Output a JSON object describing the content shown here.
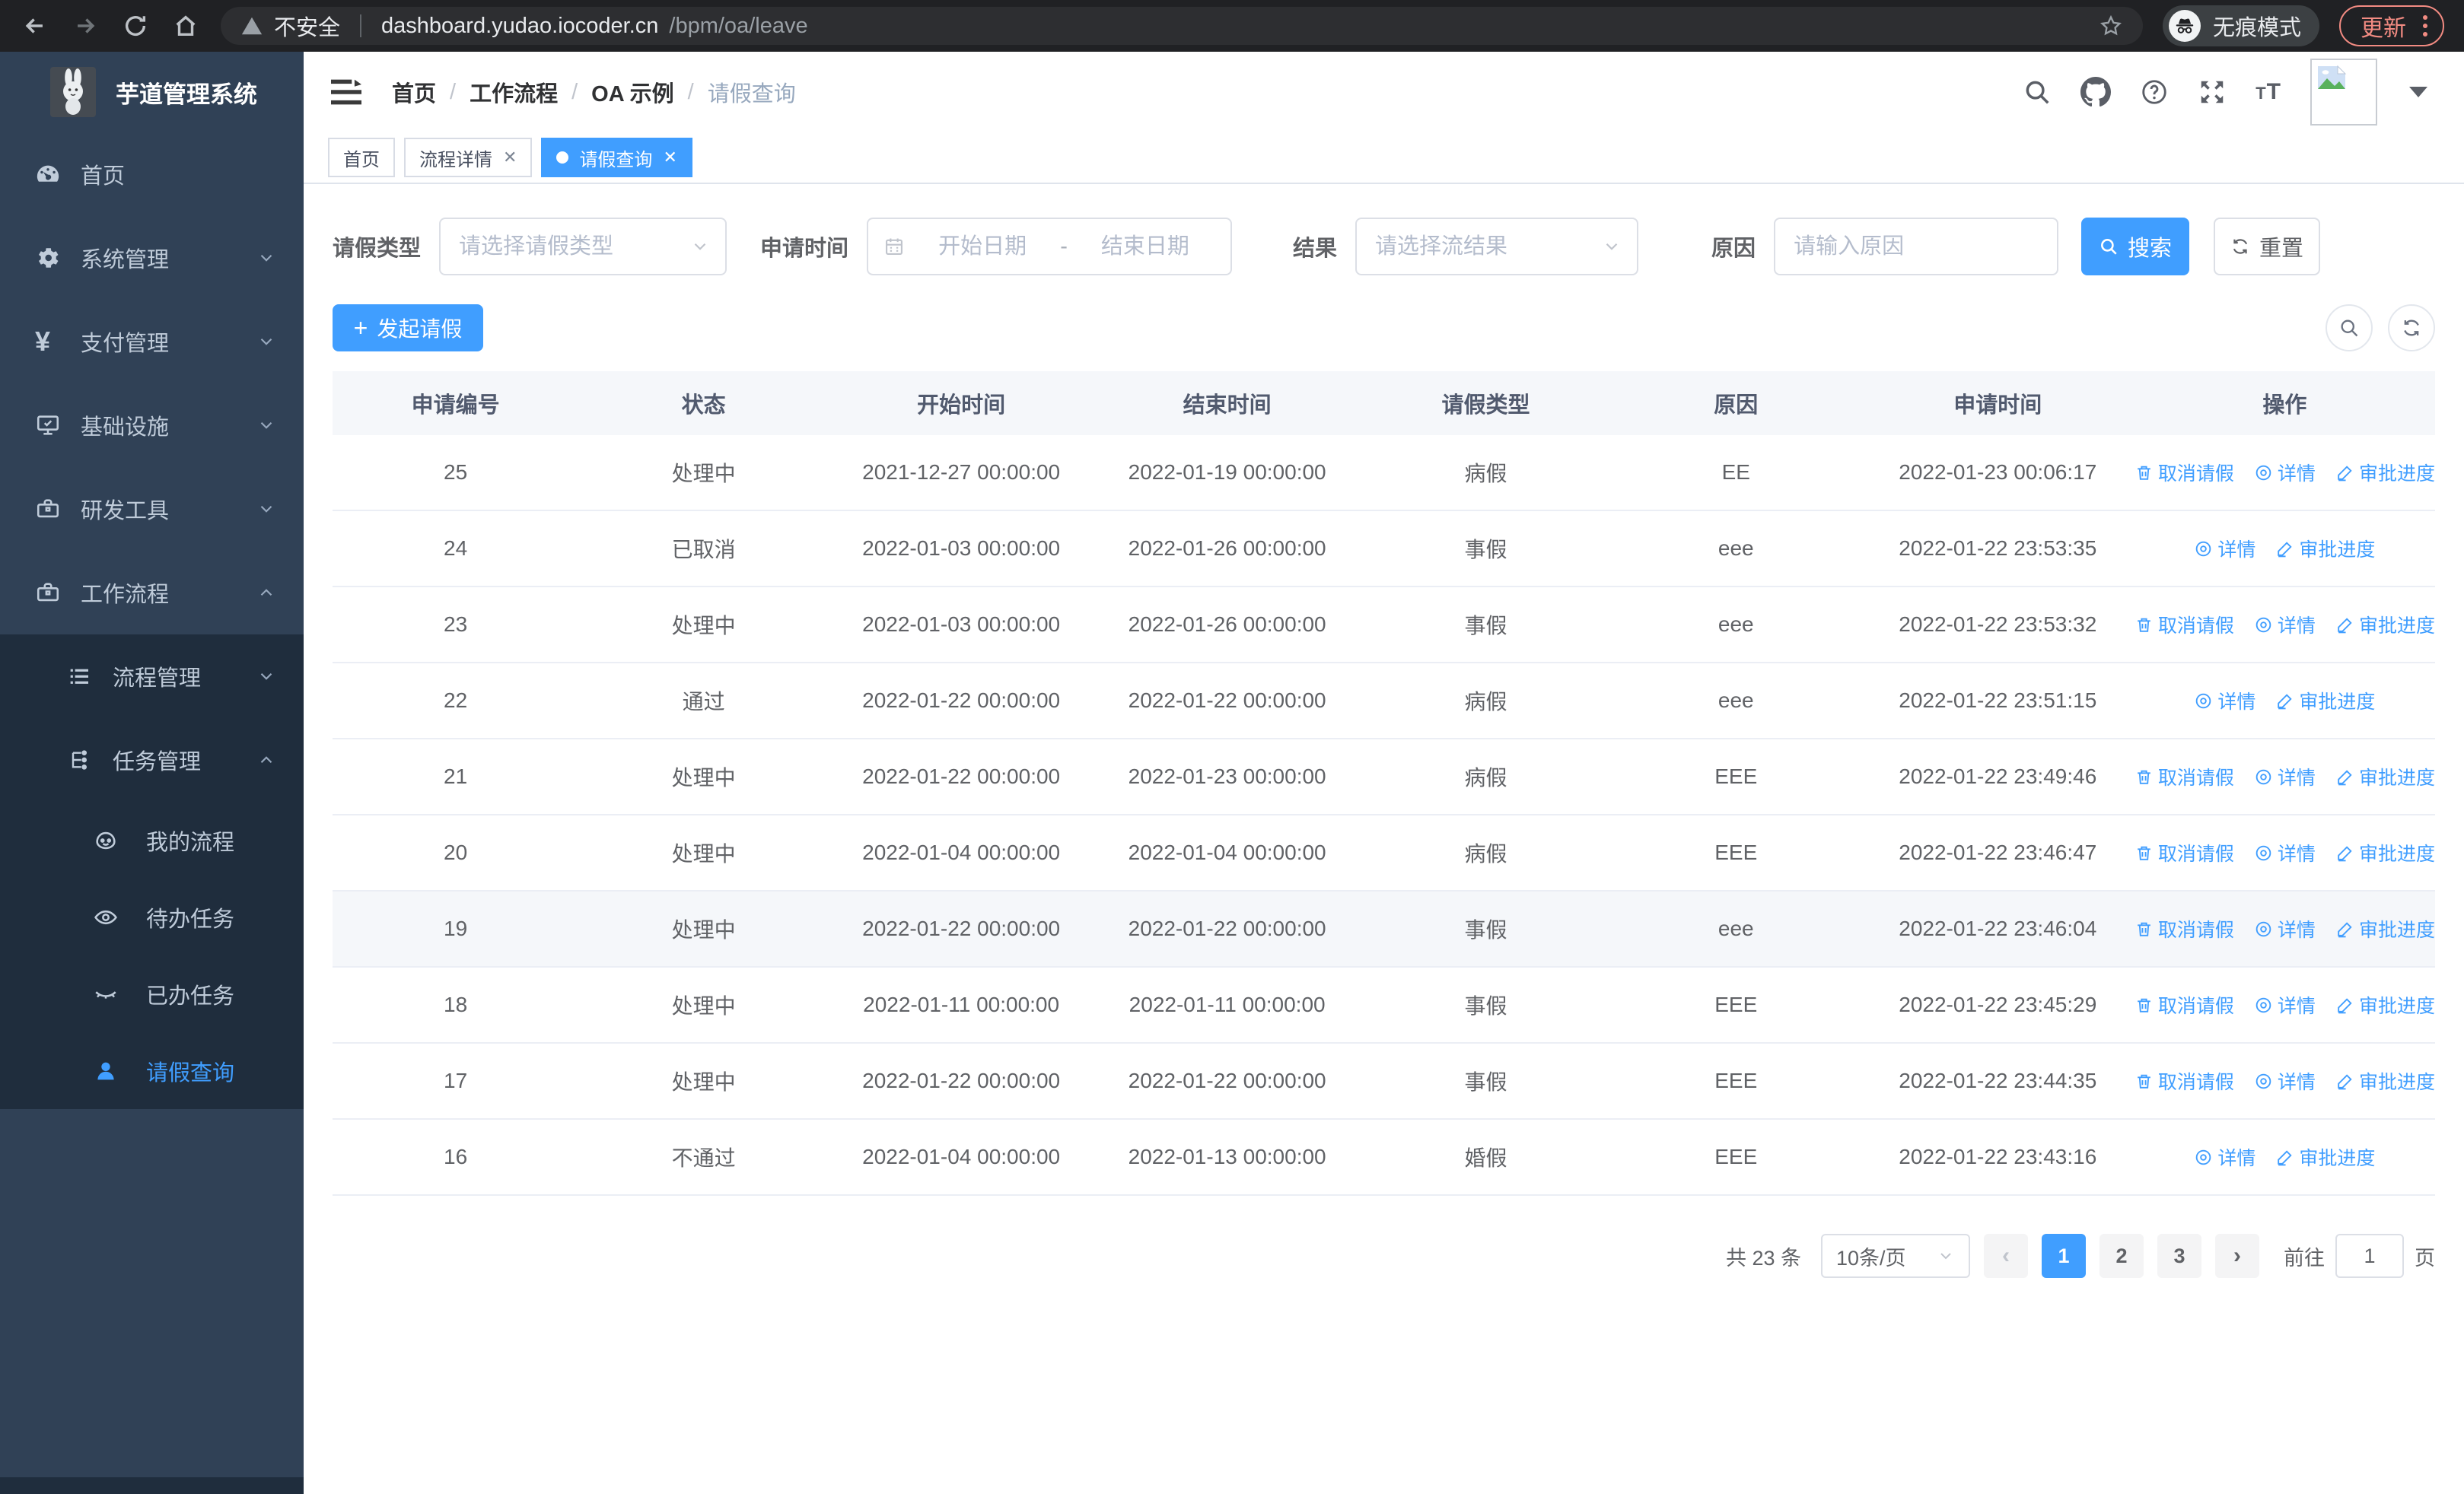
{
  "browser": {
    "security_label": "不安全",
    "url_host": "dashboard.yudao.iocoder.cn",
    "url_path": "/bpm/oa/leave",
    "incognito_label": "无痕模式",
    "update_label": "更新"
  },
  "app_title": "芋道管理系统",
  "breadcrumb": {
    "items": [
      "首页",
      "工作流程",
      "OA 示例",
      "请假查询"
    ]
  },
  "tabs": {
    "items": [
      {
        "label": "首页",
        "closable": false,
        "active": false
      },
      {
        "label": "流程详情",
        "closable": true,
        "active": false
      },
      {
        "label": "请假查询",
        "closable": true,
        "active": true
      }
    ]
  },
  "sidebar": {
    "items": [
      {
        "label": "首页"
      },
      {
        "label": "系统管理"
      },
      {
        "label": "支付管理"
      },
      {
        "label": "基础设施"
      },
      {
        "label": "研发工具"
      },
      {
        "label": "工作流程"
      },
      {
        "label": "流程管理"
      },
      {
        "label": "任务管理"
      },
      {
        "label": "我的流程"
      },
      {
        "label": "待办任务"
      },
      {
        "label": "已办任务"
      },
      {
        "label": "请假查询"
      }
    ]
  },
  "filters": {
    "leave_type": {
      "label": "请假类型",
      "placeholder": "请选择请假类型"
    },
    "apply_time": {
      "label": "申请时间",
      "start_placeholder": "开始日期",
      "separator": "-",
      "end_placeholder": "结束日期"
    },
    "result": {
      "label": "结果",
      "placeholder": "请选择流结果"
    },
    "reason": {
      "label": "原因",
      "placeholder": "请输入原因"
    },
    "search_label": "搜索",
    "reset_label": "重置"
  },
  "toolbar": {
    "create_label": "发起请假"
  },
  "table": {
    "columns": [
      "申请编号",
      "状态",
      "开始时间",
      "结束时间",
      "请假类型",
      "原因",
      "申请时间",
      "操作"
    ],
    "row_actions": {
      "cancel": "取消请假",
      "detail": "详情",
      "progress": "审批进度"
    },
    "rows": [
      {
        "id": "25",
        "status": "处理中",
        "start": "2021-12-27 00:00:00",
        "end": "2022-01-19 00:00:00",
        "type": "病假",
        "reason": "EE",
        "applied": "2022-01-23 00:06:17",
        "can_cancel": true,
        "highlight": false
      },
      {
        "id": "24",
        "status": "已取消",
        "start": "2022-01-03 00:00:00",
        "end": "2022-01-26 00:00:00",
        "type": "事假",
        "reason": "eee",
        "applied": "2022-01-22 23:53:35",
        "can_cancel": false,
        "highlight": false
      },
      {
        "id": "23",
        "status": "处理中",
        "start": "2022-01-03 00:00:00",
        "end": "2022-01-26 00:00:00",
        "type": "事假",
        "reason": "eee",
        "applied": "2022-01-22 23:53:32",
        "can_cancel": true,
        "highlight": false
      },
      {
        "id": "22",
        "status": "通过",
        "start": "2022-01-22 00:00:00",
        "end": "2022-01-22 00:00:00",
        "type": "病假",
        "reason": "eee",
        "applied": "2022-01-22 23:51:15",
        "can_cancel": false,
        "highlight": false
      },
      {
        "id": "21",
        "status": "处理中",
        "start": "2022-01-22 00:00:00",
        "end": "2022-01-23 00:00:00",
        "type": "病假",
        "reason": "EEE",
        "applied": "2022-01-22 23:49:46",
        "can_cancel": true,
        "highlight": false
      },
      {
        "id": "20",
        "status": "处理中",
        "start": "2022-01-04 00:00:00",
        "end": "2022-01-04 00:00:00",
        "type": "病假",
        "reason": "EEE",
        "applied": "2022-01-22 23:46:47",
        "can_cancel": true,
        "highlight": false
      },
      {
        "id": "19",
        "status": "处理中",
        "start": "2022-01-22 00:00:00",
        "end": "2022-01-22 00:00:00",
        "type": "事假",
        "reason": "eee",
        "applied": "2022-01-22 23:46:04",
        "can_cancel": true,
        "highlight": true
      },
      {
        "id": "18",
        "status": "处理中",
        "start": "2022-01-11 00:00:00",
        "end": "2022-01-11 00:00:00",
        "type": "事假",
        "reason": "EEE",
        "applied": "2022-01-22 23:45:29",
        "can_cancel": true,
        "highlight": false
      },
      {
        "id": "17",
        "status": "处理中",
        "start": "2022-01-22 00:00:00",
        "end": "2022-01-22 00:00:00",
        "type": "事假",
        "reason": "EEE",
        "applied": "2022-01-22 23:44:35",
        "can_cancel": true,
        "highlight": false
      },
      {
        "id": "16",
        "status": "不通过",
        "start": "2022-01-04 00:00:00",
        "end": "2022-01-13 00:00:00",
        "type": "婚假",
        "reason": "EEE",
        "applied": "2022-01-22 23:43:16",
        "can_cancel": false,
        "highlight": false
      }
    ]
  },
  "pagination": {
    "total_label": "共 23 条",
    "page_size_label": "10条/页",
    "pages": [
      "1",
      "2",
      "3"
    ],
    "active_page": "1",
    "goto_label": "前往",
    "goto_value": "1",
    "goto_suffix": "页"
  },
  "colors": {
    "primary": "#409eff",
    "sidebar_bg": "#304156",
    "submenu_bg": "#1f2d3d",
    "link_blue": "#409eff"
  }
}
